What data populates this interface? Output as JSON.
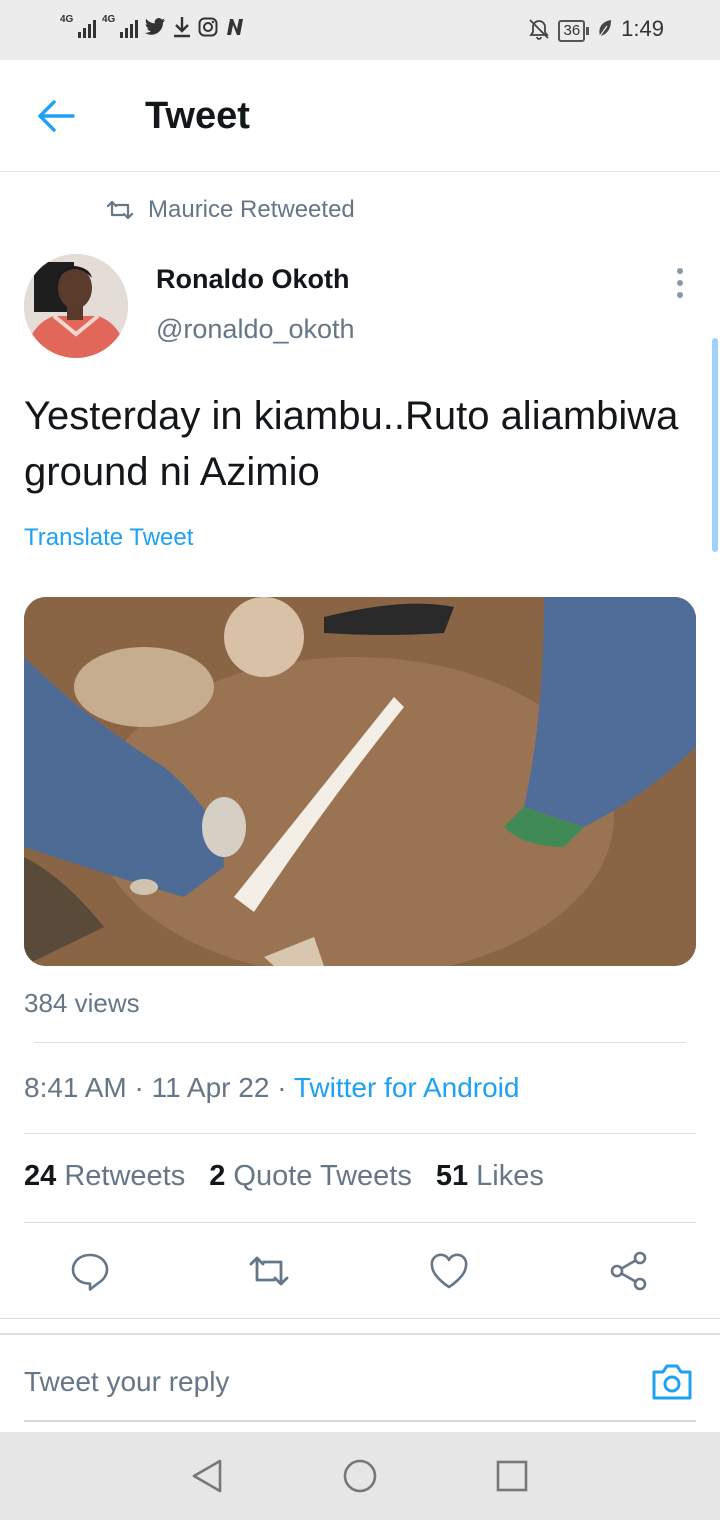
{
  "status_bar": {
    "network1": "4G",
    "network2": "4G",
    "app_icons": [
      "twitter-icon",
      "download-icon",
      "instagram-icon",
      "n-icon"
    ],
    "battery": "36",
    "time": "1:49"
  },
  "header": {
    "title": "Tweet"
  },
  "tweet": {
    "retweeted_by": "Maurice Retweeted",
    "author_name": "Ronaldo Okoth",
    "author_handle": "@ronaldo_okoth",
    "text": "Yesterday in kiambu..Ruto aliambiwa ground ni Azimio",
    "translate_label": "Translate Tweet",
    "views": "384 views",
    "time": "8:41 AM",
    "date": "11 Apr 22",
    "source": "Twitter for Android",
    "retweets_count": "24",
    "retweets_label": "Retweets",
    "quote_count": "2",
    "quote_label": "Quote Tweets",
    "likes_count": "51",
    "likes_label": "Likes"
  },
  "reply": {
    "placeholder": "Tweet your reply"
  },
  "colors": {
    "accent": "#1da1f2",
    "secondary_text": "#657786",
    "primary_text": "#14171a"
  }
}
